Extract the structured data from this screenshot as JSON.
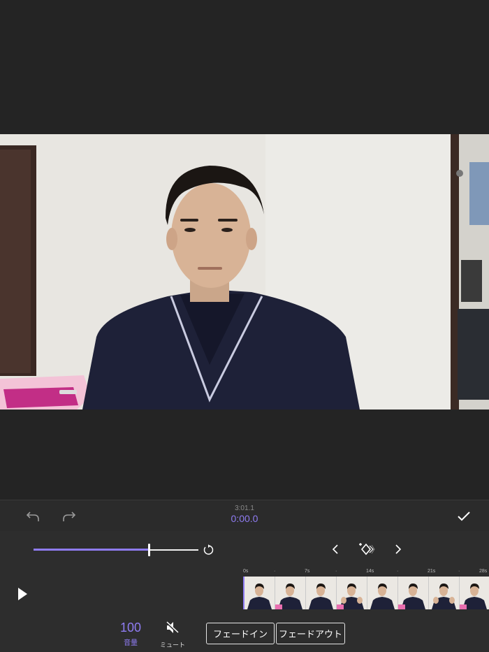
{
  "timecode": {
    "total": "3:01.1",
    "current": "0:00.0"
  },
  "volume": {
    "value": "100",
    "label": "音量",
    "level_fraction": 0.7
  },
  "mute": {
    "label": "ミュート"
  },
  "fade": {
    "in_label": "フェードイン",
    "out_label": "フェードアウト"
  },
  "timeline": {
    "ticks": [
      "0s",
      "·",
      "7s",
      "·",
      "14s",
      "·",
      "21s",
      "·",
      "28s"
    ]
  },
  "colors": {
    "accent": "#8f7cf2",
    "background": "#242424",
    "panel": "#2d2d2d"
  },
  "icons": [
    "undo-icon",
    "redo-icon",
    "checkmark-icon",
    "reset-icon",
    "chevron-left-icon",
    "keyframe-add-icon",
    "chevron-right-icon",
    "play-icon",
    "mute-icon"
  ]
}
